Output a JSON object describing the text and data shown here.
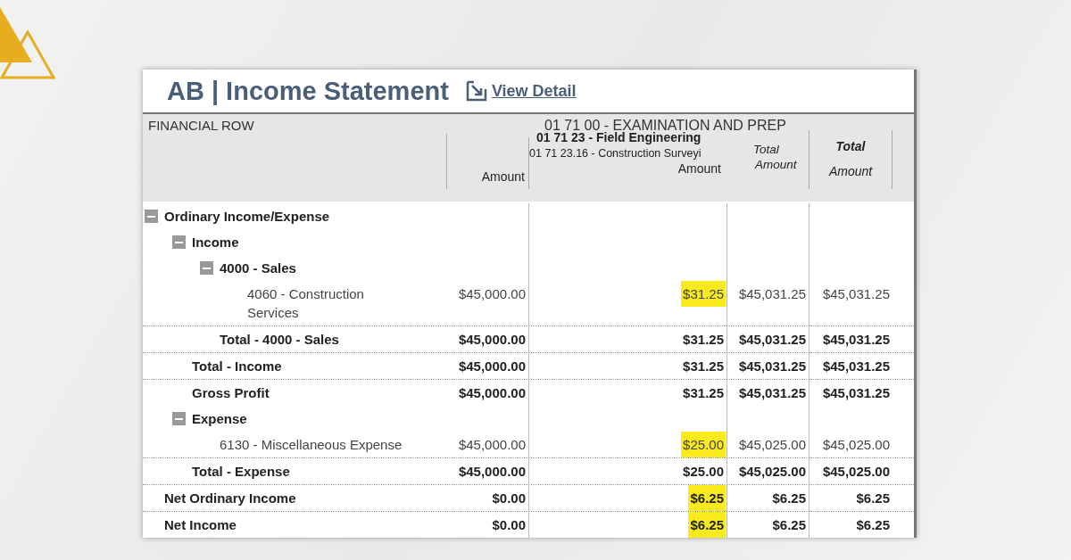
{
  "report": {
    "title": "AB | Income Statement",
    "view_detail_link": "View Detail",
    "header": {
      "financial_row": "FINANCIAL ROW",
      "group": "01 71 00 - EXAMINATION AND PREP",
      "subgroup": "01 71 23 - Field Engineering",
      "total_group": "Total",
      "amount": "Amount",
      "account": "01 71 23.16 - Construction Surveyi",
      "account_amount": "Amount",
      "subtotal_top": "Total",
      "subtotal_bottom": "Amount",
      "total_amount": "Amount"
    },
    "rows": [
      {
        "label": "Ordinary Income/Expense",
        "kind": "group",
        "expanded": true,
        "children": [
          {
            "label": "Income",
            "kind": "group",
            "expanded": true,
            "children": [
              {
                "label": "4000 - Sales",
                "kind": "group",
                "expanded": true,
                "children": [
                  {
                    "label": "4060 - Construction Services",
                    "kind": "detail",
                    "cells": [
                      {
                        "text": "$45,000.00",
                        "highlighted": false
                      },
                      {
                        "text": "$31.25",
                        "highlighted": true
                      },
                      {
                        "text": "$45,031.25",
                        "highlighted": false
                      },
                      {
                        "text": "$45,031.25",
                        "highlighted": false
                      }
                    ]
                  }
                ]
              },
              {
                "label": "Total - 4000 - Sales",
                "kind": "total",
                "cells": [
                  {
                    "text": "$45,000.00",
                    "highlighted": false
                  },
                  {
                    "text": "$31.25",
                    "highlighted": false
                  },
                  {
                    "text": "$45,031.25",
                    "highlighted": false
                  },
                  {
                    "text": "$45,031.25",
                    "highlighted": false
                  }
                ]
              }
            ]
          },
          {
            "label": "Total - Income",
            "kind": "total",
            "cells": [
              {
                "text": "$45,000.00",
                "highlighted": false
              },
              {
                "text": "$31.25",
                "highlighted": false
              },
              {
                "text": "$45,031.25",
                "highlighted": false
              },
              {
                "text": "$45,031.25",
                "highlighted": false
              }
            ]
          },
          {
            "label": "Gross Profit",
            "kind": "total",
            "cells": [
              {
                "text": "$45,000.00",
                "highlighted": false
              },
              {
                "text": "$31.25",
                "highlighted": false
              },
              {
                "text": "$45,031.25",
                "highlighted": false
              },
              {
                "text": "$45,031.25",
                "highlighted": false
              }
            ]
          },
          {
            "label": "Expense",
            "kind": "group",
            "expanded": true,
            "children": [
              {
                "label": "6130 - Miscellaneous Expense",
                "kind": "detail",
                "cells": [
                  {
                    "text": "$45,000.00",
                    "highlighted": false
                  },
                  {
                    "text": "$25.00",
                    "highlighted": true
                  },
                  {
                    "text": "$45,025.00",
                    "highlighted": false
                  },
                  {
                    "text": "$45,025.00",
                    "highlighted": false
                  }
                ]
              }
            ]
          },
          {
            "label": "Total - Expense",
            "kind": "total",
            "cells": [
              {
                "text": "$45,000.00",
                "highlighted": false
              },
              {
                "text": "$25.00",
                "highlighted": false
              },
              {
                "text": "$45,025.00",
                "highlighted": false
              },
              {
                "text": "$45,025.00",
                "highlighted": false
              }
            ]
          }
        ]
      },
      {
        "label": "Net Ordinary Income",
        "kind": "total",
        "cells": [
          {
            "text": "$0.00",
            "highlighted": false
          },
          {
            "text": "$6.25",
            "highlighted": true
          },
          {
            "text": "$6.25",
            "highlighted": false
          },
          {
            "text": "$6.25",
            "highlighted": false
          }
        ]
      },
      {
        "label": "Net Income",
        "kind": "total",
        "cells": [
          {
            "text": "$0.00",
            "highlighted": false
          },
          {
            "text": "$6.25",
            "highlighted": true
          },
          {
            "text": "$6.25",
            "highlighted": false
          },
          {
            "text": "$6.25",
            "highlighted": false
          }
        ]
      }
    ]
  }
}
